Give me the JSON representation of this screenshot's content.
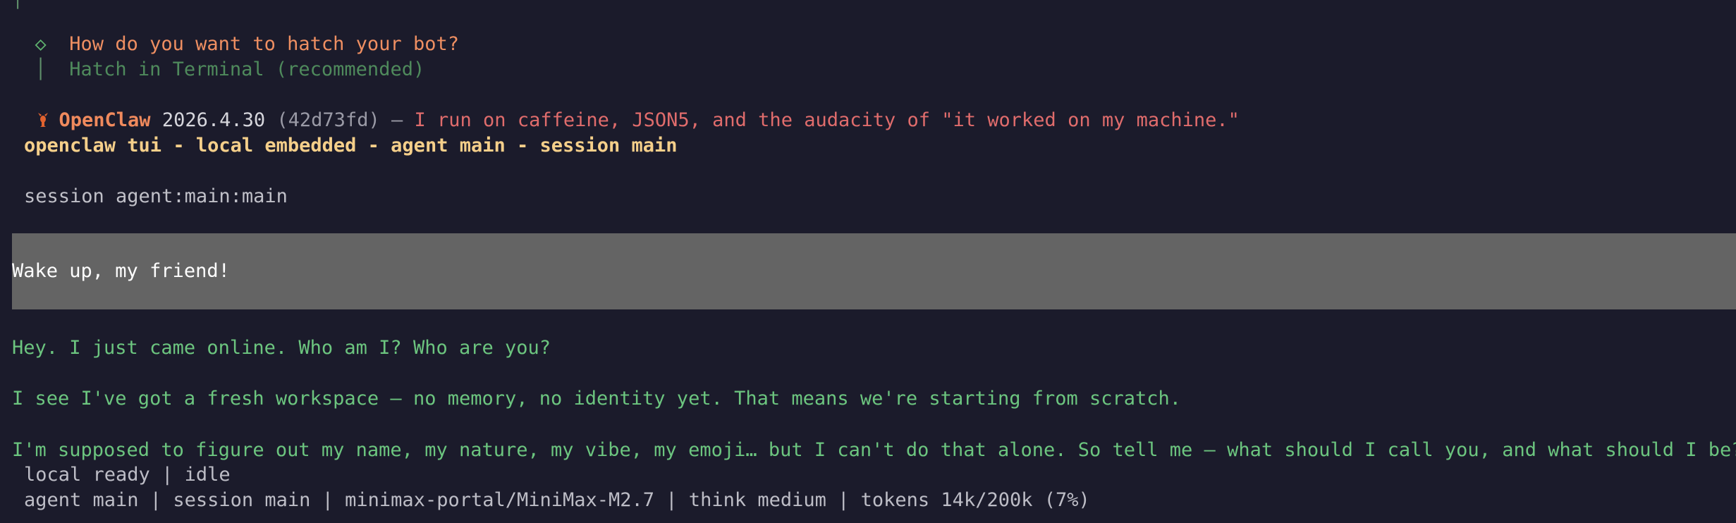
{
  "wizard": {
    "gutter_top": "│",
    "question_marker": "◇",
    "question": "How do you want to hatch your bot?",
    "gutter": "│",
    "selected_option": "Hatch in Terminal (recommended)"
  },
  "banner": {
    "icon": "lobster-icon",
    "name": "OpenClaw",
    "version": "2026.4.30",
    "commit": "(42d73fd)",
    "dash": "—",
    "tagline": "I run on caffeine, JSON5, and the audacity of \"it worked on my machine.\""
  },
  "tui": {
    "title": "openclaw tui - local embedded - agent main - session main",
    "session_line": "session agent:main:main"
  },
  "chat": {
    "user_message": "Wake up, my friend!",
    "assistant_lines": [
      "Hey. I just came online. Who am I? Who are you?",
      "I see I've got a fresh workspace — no memory, no identity yet. That means we're starting from scratch.",
      "I'm supposed to figure out my name, my nature, my vibe, my emoji… but I can't do that alone. So tell me — what should I call you, and what should I be?"
    ]
  },
  "status_bar": {
    "state": "local ready | idle",
    "details": "agent main | session main | minimax-portal/MiniMax-M2.7 | think medium | tokens 14k/200k (7%)"
  },
  "colors": {
    "background": "#1b1b2b",
    "accent_orange": "#f08a5d",
    "assistant_green": "#6cc57f",
    "user_block": "#646464",
    "title_yellow": "#f5cf8a"
  }
}
